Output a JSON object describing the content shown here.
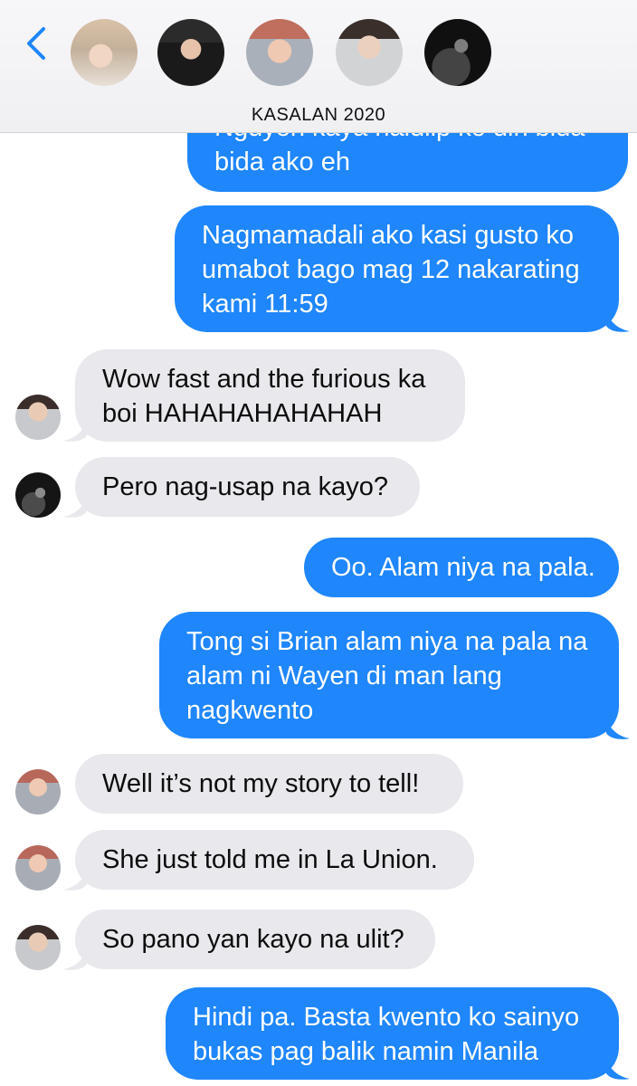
{
  "header": {
    "title": "KASALAN 2020",
    "back_icon": "chevron-left-icon",
    "accent": "#1f86fb"
  },
  "messages": [
    {
      "dir": "out",
      "lines": [
        "Nguyen kaya naidlip ko din bida",
        "bida ako eh"
      ]
    },
    {
      "dir": "out",
      "lines": [
        "Nagmamadali ako kasi gusto ko",
        "umabot bago mag 12 nakarating",
        "kami 11:59"
      ]
    },
    {
      "dir": "in",
      "lines": [
        "Wow fast and the furious ka",
        "boi HAHAHAHAHAHAH"
      ]
    },
    {
      "dir": "in",
      "lines": [
        "Pero nag-usap na kayo?"
      ]
    },
    {
      "dir": "out",
      "lines": [
        "Oo. Alam niya na pala."
      ]
    },
    {
      "dir": "out",
      "lines": [
        "Tong si Brian alam niya na pala na",
        "alam ni Wayen di man lang",
        "nagkwento"
      ]
    },
    {
      "dir": "in",
      "lines": [
        "Well it’s not my story to tell!"
      ]
    },
    {
      "dir": "in",
      "lines": [
        "She just told me in La Union."
      ]
    },
    {
      "dir": "in",
      "lines": [
        "So pano yan kayo na ulit?"
      ]
    },
    {
      "dir": "out",
      "lines": [
        "Hindi pa. Basta kwento ko sainyo",
        "bukas pag balik namin Manila"
      ]
    }
  ],
  "colors": {
    "outgoing_bubble": "#1f86fb",
    "incoming_bubble": "#e8e8ed"
  }
}
